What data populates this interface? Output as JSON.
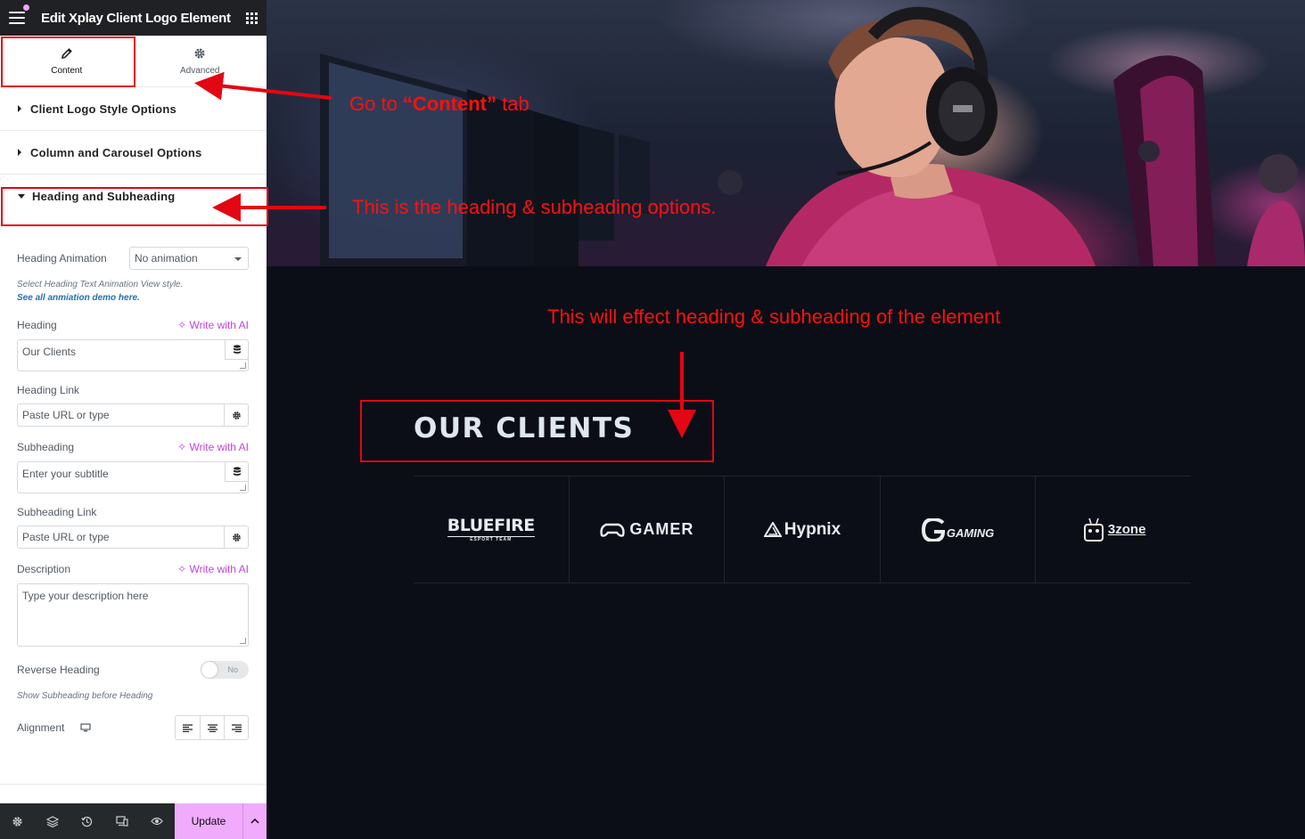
{
  "editor": {
    "title": "Edit Xplay Client Logo Element",
    "tabs": [
      {
        "label": "Content",
        "icon": "pencil-icon",
        "active": true
      },
      {
        "label": "Advanced",
        "icon": "gear-icon",
        "active": false
      }
    ],
    "sections": {
      "client_logo_style": "Client Logo Style Options",
      "column_carousel": "Column and Carousel Options",
      "heading_subheading": "Heading and Subheading"
    },
    "controls": {
      "heading_animation": {
        "label": "Heading Animation",
        "value": "No animation"
      },
      "animation_hint": "Select Heading Text Animation View style.",
      "animation_link": "See all anmiation demo here.",
      "write_ai": "Write with AI",
      "heading": {
        "label": "Heading",
        "value": "Our Clients"
      },
      "heading_link": {
        "label": "Heading Link",
        "placeholder": "Paste URL or type"
      },
      "subheading": {
        "label": "Subheading",
        "placeholder": "Enter your subtitle"
      },
      "subheading_link": {
        "label": "Subheading Link",
        "placeholder": "Paste URL or type"
      },
      "description": {
        "label": "Description",
        "placeholder": "Type your description here"
      },
      "reverse_heading": {
        "label": "Reverse Heading",
        "value": "No"
      },
      "reverse_hint": "Show Subheading before Heading",
      "alignment": {
        "label": "Alignment"
      }
    },
    "footer": {
      "update_label": "Update"
    }
  },
  "preview": {
    "heading": "OUR CLIENTS",
    "logos": [
      "BLUEFIRE",
      "GAMER",
      "Hypnix",
      "GAMING",
      "3zone"
    ],
    "logo_sub": "ESPORT TEAM"
  },
  "annotations": {
    "content_tab_pre": "Go  to ",
    "content_tab_word": "“Content”",
    "content_tab_post": " tab",
    "heading_options": "This is the heading & subheading options.",
    "effect": "This will effect heading & subheading of the element"
  },
  "colors": {
    "annotation": "#ff1010",
    "accent": "#f0abfc",
    "ai": "#c244dd"
  }
}
